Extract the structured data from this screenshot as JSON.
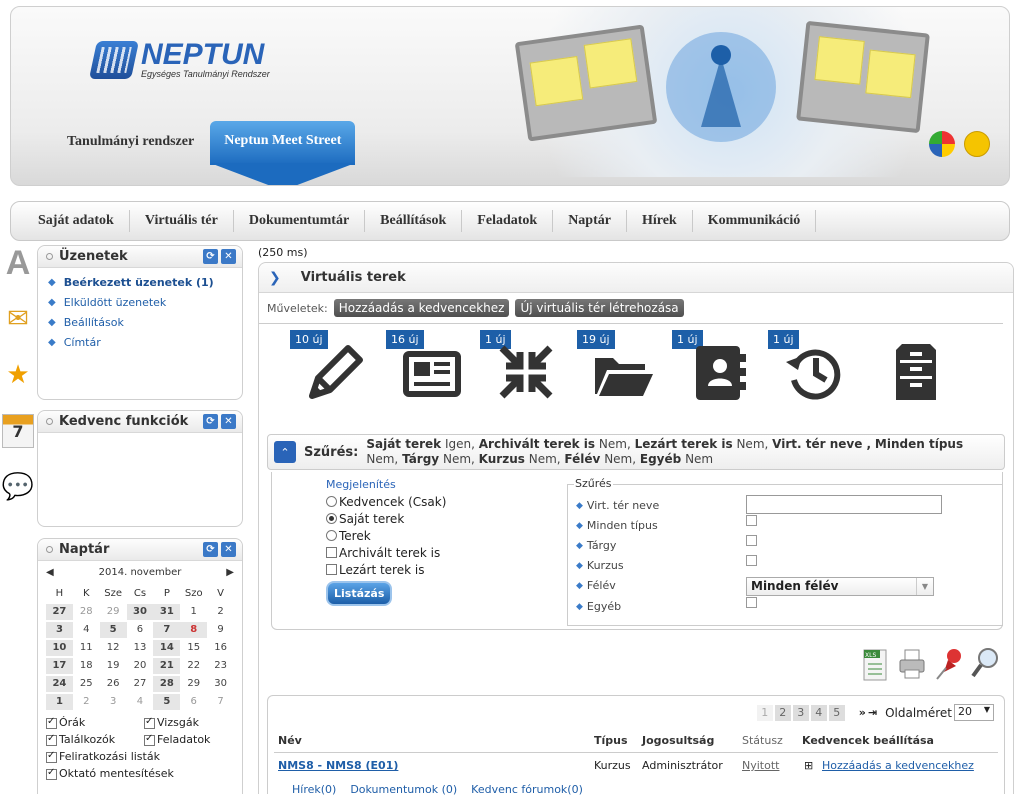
{
  "header": {
    "logo_name": "NEPTUN",
    "logo_sub": "Egységes Tanulmányi Rendszer",
    "tab_plain": "Tanulmányi rendszer",
    "tab_active": "Neptun Meet Street"
  },
  "nav": [
    "Saját adatok",
    "Virtuális tér",
    "Dokumentumtár",
    "Beállítások",
    "Feladatok",
    "Naptár",
    "Hírek",
    "Kommunikáció"
  ],
  "timing": "(250 ms)",
  "messages_box": {
    "title": "Üzenetek",
    "items": [
      "Beérkezett üzenetek (1)",
      "Elküldött üzenetek",
      "Beállítások",
      "Címtár"
    ]
  },
  "fav_box": {
    "title": "Kedvenc funkciók"
  },
  "calendar_box": {
    "title": "Naptár",
    "month": "2014. november",
    "weekdays": [
      "H",
      "K",
      "Sze",
      "Cs",
      "P",
      "Szo",
      "V"
    ],
    "weeks": [
      [
        "27",
        "28",
        "29",
        "30",
        "31",
        "1",
        "2"
      ],
      [
        "3",
        "4",
        "5",
        "6",
        "7",
        "8",
        "9"
      ],
      [
        "10",
        "11",
        "12",
        "13",
        "14",
        "15",
        "16"
      ],
      [
        "17",
        "18",
        "19",
        "20",
        "21",
        "22",
        "23"
      ],
      [
        "24",
        "25",
        "26",
        "27",
        "28",
        "29",
        "30"
      ],
      [
        "1",
        "2",
        "3",
        "4",
        "5",
        "6",
        "7"
      ]
    ],
    "checks": [
      "Órák",
      "Vizsgák",
      "Találkozók",
      "Feladatok",
      "Feliratkozási listák",
      "Oktató mentesítések"
    ]
  },
  "panel": {
    "title": "Virtuális terek",
    "ops_label": "Műveletek:",
    "op_buttons": [
      "Hozzáadás a kedvencekhez",
      "Új virtuális tér létrehozása"
    ],
    "tiles": [
      "10 új",
      "16 új",
      "1 új",
      "19 új",
      "1 új",
      "1 új"
    ]
  },
  "filter": {
    "label": "Szűrés:",
    "summary": [
      {
        "k": "Saját terek",
        "v": "Igen"
      },
      {
        "k": "Archivált terek is",
        "v": "Nem"
      },
      {
        "k": "Lezárt terek is",
        "v": "Nem"
      },
      {
        "k": "Virt. tér neve ,",
        "v": ""
      },
      {
        "k": "Minden típus",
        "v": "Nem"
      },
      {
        "k": "Tárgy",
        "v": "Nem"
      },
      {
        "k": "Kurzus",
        "v": "Nem"
      },
      {
        "k": "Félév",
        "v": "Nem"
      },
      {
        "k": "Egyéb",
        "v": "Nem"
      }
    ],
    "display_legend": "Megjelenítés",
    "display_options": [
      "Kedvencek (Csak)",
      "Saját terek",
      "Terek",
      "Archivált terek is",
      "Lezárt terek is"
    ],
    "list_button": "Listázás",
    "filter_legend": "Szűrés",
    "filter_fields": [
      "Virt. tér neve",
      "Minden típus",
      "Tárgy",
      "Kurzus",
      "Félév",
      "Egyéb"
    ],
    "semester_value": "Minden félév"
  },
  "grid": {
    "pages": [
      "1",
      "2",
      "3",
      "4",
      "5"
    ],
    "page_size_label": "Oldalméret",
    "page_size": "20",
    "headers": [
      "Név",
      "Típus",
      "Jogosultság",
      "Státusz",
      "Kedvencek beállítása"
    ],
    "row": {
      "name": "NMS8 - NMS8 (E01)",
      "type": "Kurzus",
      "role": "Adminisztrátor",
      "status": "Nyitott",
      "fav": "Hozzáadás a kedvencekhez",
      "sublinks": [
        "Hírek(0)",
        "Dokumentumok (0)",
        "Kedvenc fórumok(0)"
      ]
    }
  },
  "colors": {
    "accent": "#2a64b8",
    "badge": "#1d5fa8"
  }
}
